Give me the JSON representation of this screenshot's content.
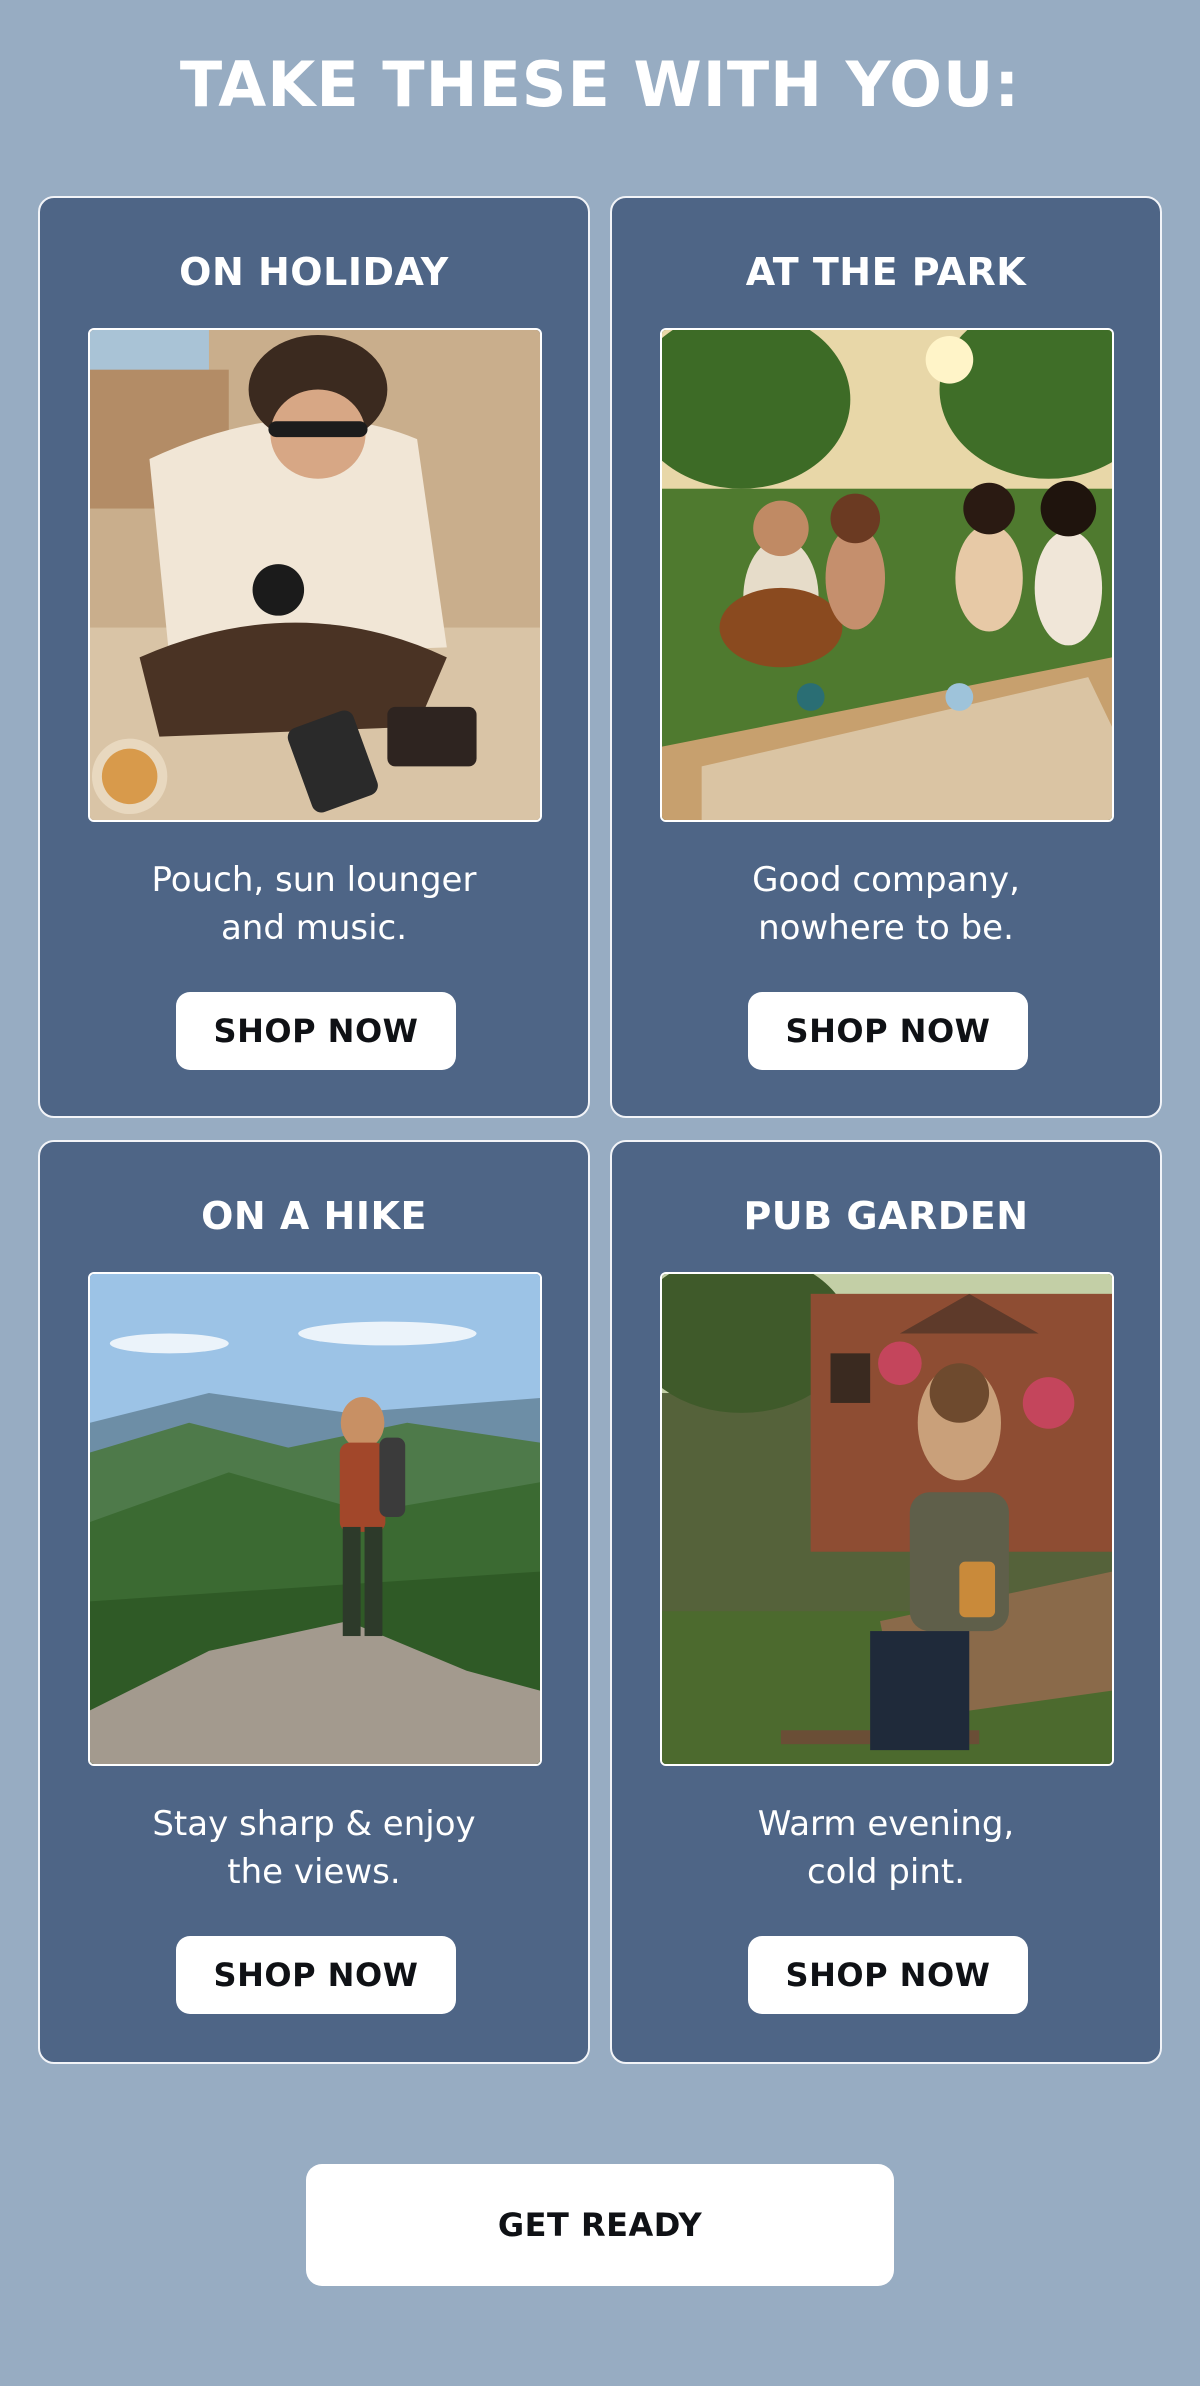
{
  "headline": "TAKE THESE WITH YOU:",
  "cards": [
    {
      "title": "ON HOLIDAY",
      "text_line1": "Pouch, sun lounger",
      "text_line2": "and music.",
      "button_label": "SHOP NOW",
      "photo_subject": "man-packing-bag-photo"
    },
    {
      "title": "AT THE PARK",
      "text_line1": "Good company,",
      "text_line2": "nowhere to be.",
      "button_label": "SHOP NOW",
      "photo_subject": "park-picnic-guitar-photo"
    },
    {
      "title": "ON A HIKE",
      "text_line1": "Stay sharp & enjoy",
      "text_line2": "the views.",
      "button_label": "SHOP NOW",
      "photo_subject": "hiker-mountain-view-photo"
    },
    {
      "title": "PUB GARDEN",
      "text_line1": "Warm evening,",
      "text_line2": "cold pint.",
      "button_label": "SHOP NOW",
      "photo_subject": "pub-garden-pint-photo"
    }
  ],
  "cta_label": "GET READY",
  "colors": {
    "page_background": "#97acc2",
    "card_background": "#4e6586",
    "button_background": "#ffffff",
    "button_text": "#0f1115"
  }
}
